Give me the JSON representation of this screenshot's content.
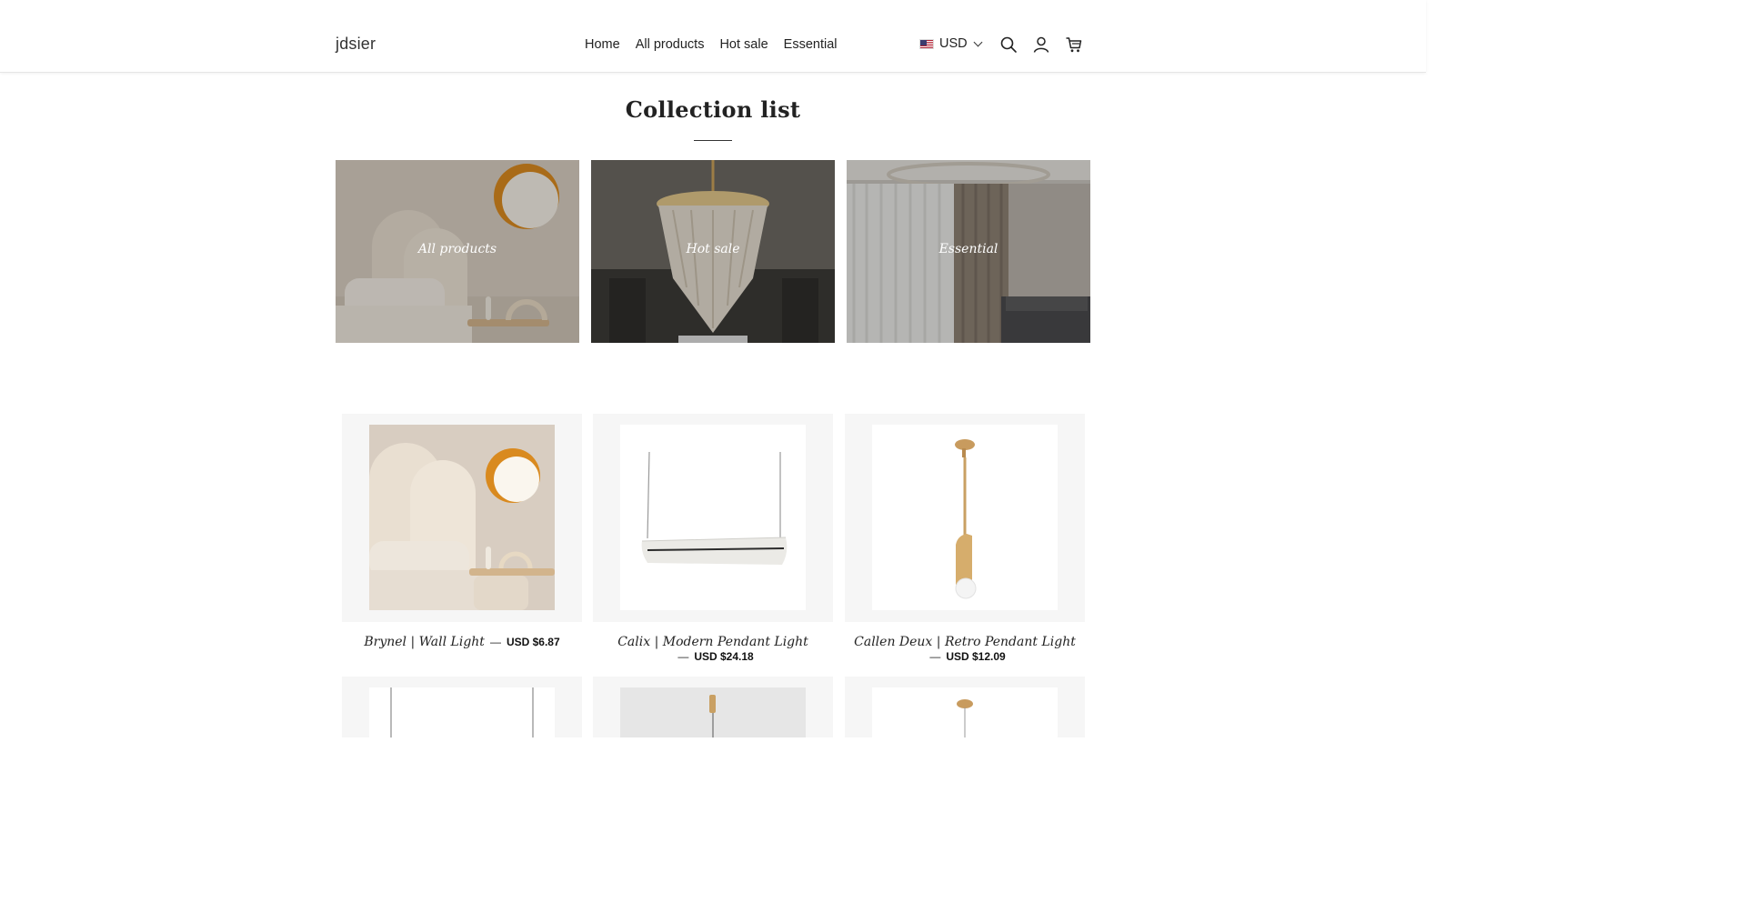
{
  "header": {
    "logo": "jdsier",
    "nav": [
      "Home",
      "All products",
      "Hot sale",
      "Essential"
    ],
    "currency": "USD"
  },
  "page_title": "Collection list",
  "collections": [
    {
      "label": "All products"
    },
    {
      "label": "Hot sale"
    },
    {
      "label": "Essential"
    }
  ],
  "products": [
    {
      "name": "Brynel | Wall Light",
      "price": "USD $6.87"
    },
    {
      "name": "Calix | Modern Pendant Light",
      "price": "USD $24.18"
    },
    {
      "name": "Callen Deux | Retro Pendant Light",
      "price": "USD $12.09"
    }
  ],
  "icons": [
    "flag-us-icon",
    "chevron-down-icon",
    "search-icon",
    "account-icon",
    "cart-icon"
  ]
}
